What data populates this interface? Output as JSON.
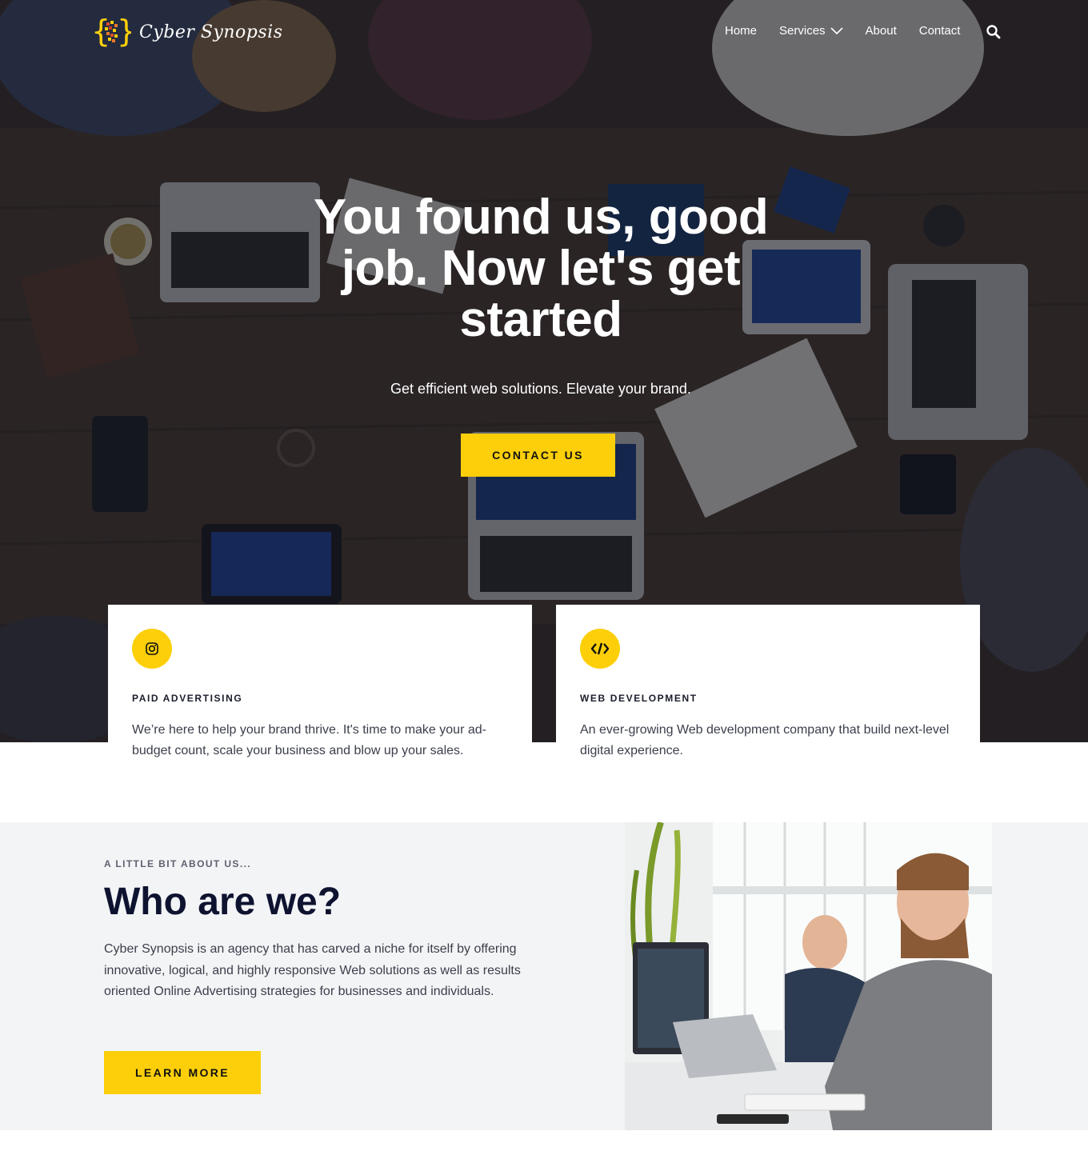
{
  "brand": {
    "name": "Cyber Synopsis",
    "accent": "#fccf0a"
  },
  "nav": {
    "items": [
      {
        "label": "Home"
      },
      {
        "label": "Services"
      },
      {
        "label": "About"
      },
      {
        "label": "Contact"
      }
    ]
  },
  "hero": {
    "title": "You found us, good job. Now let's get started",
    "subtitle": "Get efficient web solutions. Elevate your brand.",
    "cta": "CONTACT US"
  },
  "cards": [
    {
      "icon": "instagram-icon",
      "title": "PAID ADVERTISING",
      "text": "We’re here to help your brand thrive. It's time to make your ad-budget count, scale your business and blow up your sales."
    },
    {
      "icon": "code-icon",
      "title": "WEB DEVELOPMENT",
      "text": "An ever-growing Web development company that build next-level digital experience."
    }
  ],
  "about": {
    "kicker": "A LITTLE BIT ABOUT US...",
    "title": "Who are we?",
    "text": "Cyber Synopsis is an agency that has carved a niche for itself by offering innovative, logical, and highly responsive Web solutions as well as results oriented Online Advertising strategies for businesses and individuals.",
    "cta": "LEARN MORE"
  }
}
